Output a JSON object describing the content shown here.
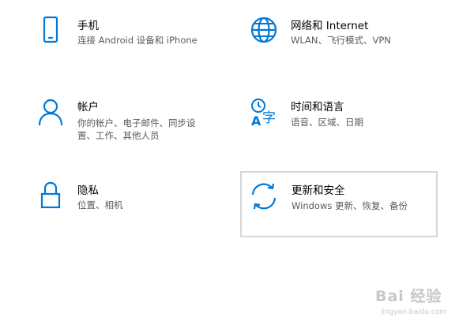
{
  "theme": {
    "accent": "#0078d7",
    "title_color": "#000000",
    "desc_color": "#5a5a5a",
    "hover_border": "#d6d6d6"
  },
  "tiles": [
    {
      "icon": "phone-icon",
      "title": "手机",
      "desc": "连接 Android 设备和 iPhone"
    },
    {
      "icon": "globe-icon",
      "title": "网络和 Internet",
      "desc": "WLAN、飞行模式、VPN"
    },
    {
      "icon": "person-icon",
      "title": "帐户",
      "desc": "你的帐户、电子邮件、同步设置、工作、其他人员"
    },
    {
      "icon": "time-language-icon",
      "title": "时间和语言",
      "desc": "语音、区域、日期"
    },
    {
      "icon": "lock-icon",
      "title": "隐私",
      "desc": "位置、相机"
    },
    {
      "icon": "sync-icon",
      "title": "更新和安全",
      "desc": "Windows 更新、恢复、备份"
    }
  ],
  "watermark": {
    "text": "Bai 经验",
    "sub": "jingyan.baidu.com"
  }
}
